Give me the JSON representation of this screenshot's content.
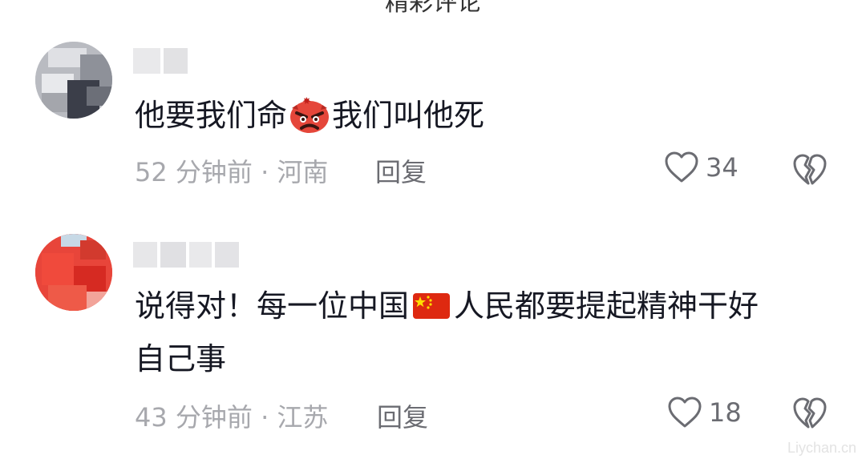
{
  "header": {
    "cut_title": "精彩评论"
  },
  "comments": [
    {
      "text_before": "他要我们命",
      "emoji": "angry-face-icon",
      "text_after": "我们叫他死",
      "time_location": "52 分钟前 · 河南",
      "reply_label": "回复",
      "likes": "34"
    },
    {
      "text_line1_before": "说得对！每一位中国",
      "emoji": "china-flag-icon",
      "text_line1_after": "人民都要提起精神干好",
      "text_line2": "自己事",
      "time_location": "43 分钟前 · 江苏",
      "reply_label": "回复",
      "likes": "18"
    }
  ],
  "watermark": "Liychan.cn",
  "colors": {
    "text": "#161823",
    "meta": "#a7a8ad",
    "action": "#6b6c72"
  }
}
